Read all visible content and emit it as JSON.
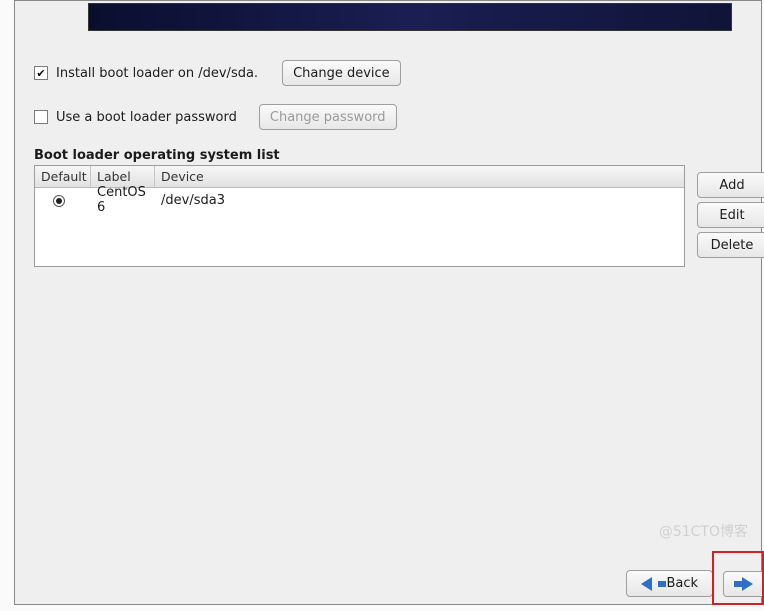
{
  "options": {
    "install_label": "Install boot loader on /dev/sda.",
    "install_checked": true,
    "change_device": "Change device",
    "use_pw_label": "Use a boot loader password",
    "use_pw_checked": false,
    "change_pw": "Change password"
  },
  "section_title": "Boot loader operating system list",
  "table": {
    "headers": {
      "default": "Default",
      "label": "Label",
      "device": "Device"
    },
    "rows": [
      {
        "default": true,
        "label": "CentOS 6",
        "device": "/dev/sda3"
      }
    ]
  },
  "side": {
    "add": "Add",
    "edit": "Edit",
    "delete": "Delete"
  },
  "nav": {
    "back": "Back",
    "next": ""
  },
  "watermark": "@51CTO博客"
}
